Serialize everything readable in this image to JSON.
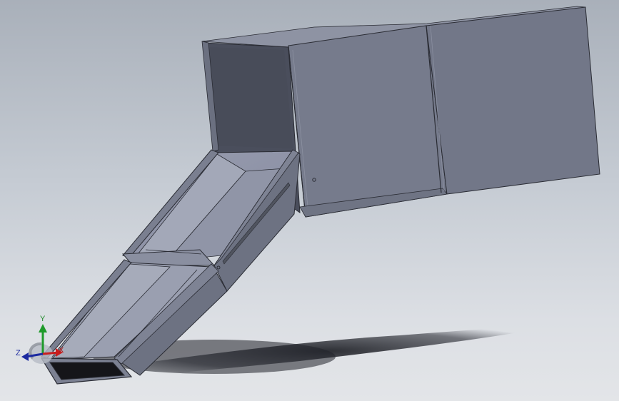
{
  "viewport": {
    "background_top": "#a9b0ba",
    "background_bottom": "#e3e5e8"
  },
  "model": {
    "body_color": "#767b8c",
    "shade_color": "#4a4e5c",
    "edge_color": "#2a2c34",
    "interior_color": "#8c91a3"
  },
  "triad": {
    "x_label": "X",
    "y_label": "Y",
    "z_label": "Z",
    "x_color": "#c81e1e",
    "y_color": "#1e9a2a",
    "z_color": "#1c2aa0"
  }
}
